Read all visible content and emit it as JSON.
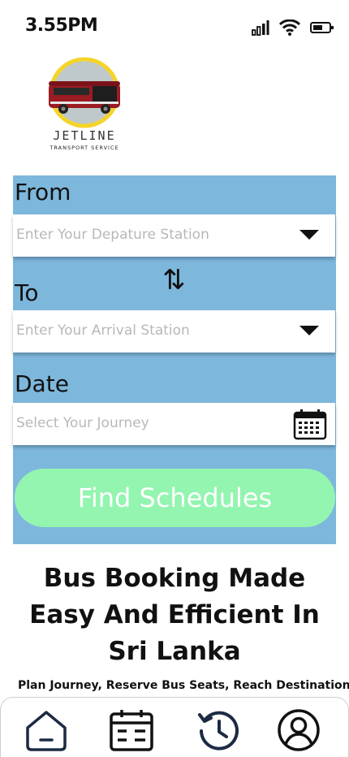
{
  "status_bar": {
    "time": "3.55PM",
    "icons": [
      "signal-icon",
      "wifi-icon",
      "battery-icon"
    ]
  },
  "logo": {
    "name": "JETLINE",
    "tagline": "TRANSPORT SERVICE",
    "colors": {
      "ring": "#f5d42a",
      "bus_body": "#9b1c22",
      "circle_fill": "#bfc9cc"
    }
  },
  "form": {
    "from_label": "From",
    "from_placeholder": "Enter Your Depature Station",
    "to_label": "To",
    "to_placeholder": "Enter  Your Arrival Station",
    "date_label": "Date",
    "date_placeholder": "Select Your Journey",
    "swap_icon": "swap-vertical-icon",
    "calendar_icon": "calendar-icon",
    "find_button_label": "Find Schedules",
    "colors": {
      "panel": "#7eb7dc",
      "button": "#93f5b0"
    }
  },
  "hero": {
    "headline": "Bus Booking Made Easy And Efficient In Sri Lanka",
    "subline": "Plan Journey, Reserve Bus Seats, Reach Destination"
  },
  "bottom_nav": {
    "items": [
      {
        "icon": "home-icon"
      },
      {
        "icon": "schedule-icon"
      },
      {
        "icon": "history-icon"
      },
      {
        "icon": "profile-icon"
      }
    ],
    "colors": {
      "home": "#1c2a44",
      "schedule": "#111111",
      "history": "#1c2a44",
      "profile": "#111111"
    }
  }
}
